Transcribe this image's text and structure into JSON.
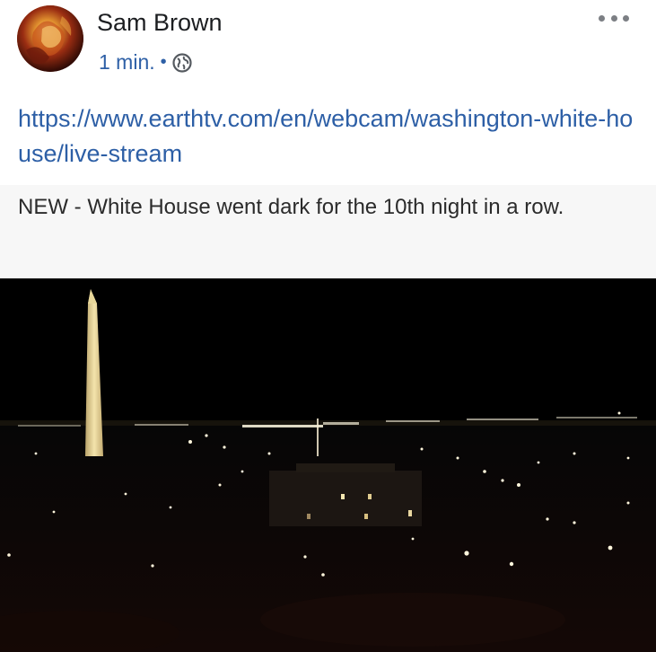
{
  "post": {
    "author": "Sam Brown",
    "timestamp": "1 min.",
    "separator": "•",
    "privacy_icon": "globe-icon",
    "more_icon": "more-options-icon",
    "link_text": "https://www.earthtv.com/en/webcam/washington-white-house/live-stream",
    "caption": "NEW - White House went dark for the 10th night in a row."
  },
  "colors": {
    "name": "#1c1e21",
    "link": "#2d5fa6",
    "caption_bg": "#f7f7f7",
    "photo_bg": "#000000"
  }
}
